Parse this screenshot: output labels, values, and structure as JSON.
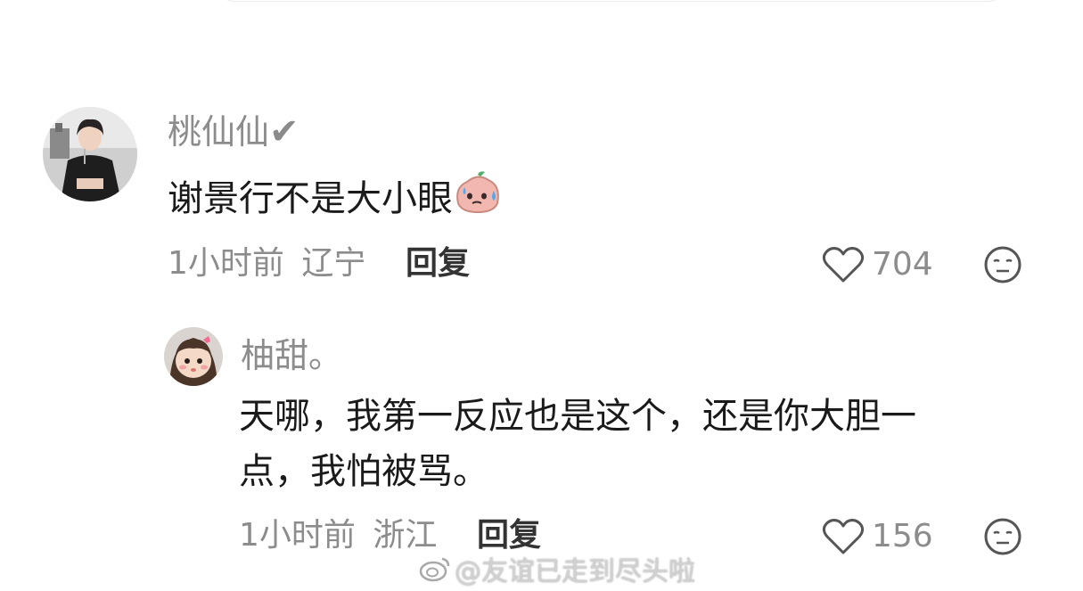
{
  "comments": [
    {
      "author": "桃仙仙",
      "verified_mark": "✔",
      "text": "谢景行不是大小眼",
      "emoji": "sweating-pink-blob-emoji",
      "time": "1小时前",
      "location": "辽宁",
      "reply_label": "回复",
      "likes": "704"
    },
    {
      "author": "柚甜。",
      "text_line1": "天哪，我第一反应也是这个，还是你大胆一",
      "text_line2": "点，我怕被骂。",
      "time": "1小时前",
      "location": "浙江",
      "reply_label": "回复",
      "likes": "156"
    }
  ],
  "watermark": "@友谊已走到尽头啦",
  "icons": {
    "like": "heart-outline-icon",
    "reaction": "expressionless-face-icon",
    "watermark": "weibo-logo-icon"
  },
  "colors": {
    "meta": "#8c8c8c",
    "content": "#1a1a1a",
    "reply": "#333333"
  }
}
